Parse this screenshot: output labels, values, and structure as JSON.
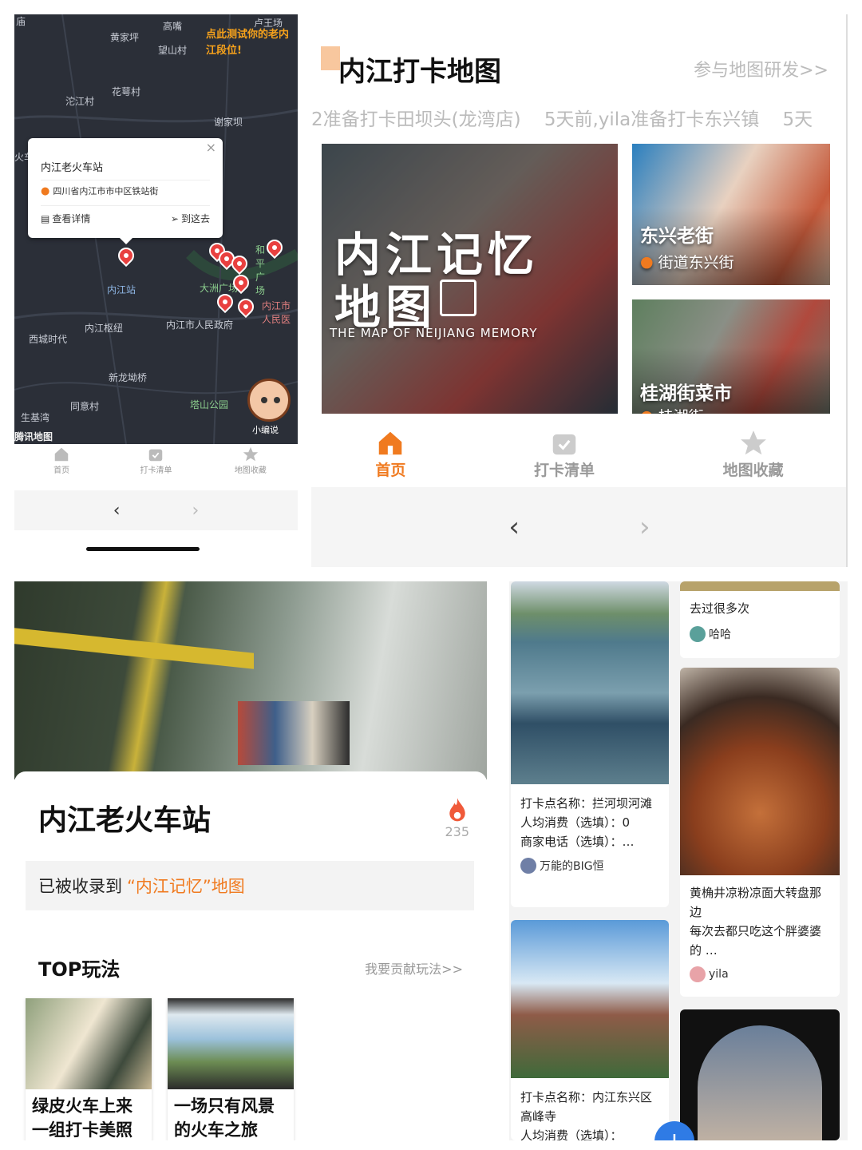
{
  "map_screen": {
    "map_labels": [
      "庙",
      "黄家坪",
      "高嘴",
      "卢王场",
      "望山村",
      "沱江村",
      "花萼村",
      "谢家坝",
      "火车",
      "内江站",
      "大洲广场",
      "和平广场",
      "内江枢纽",
      "内江市人民政府",
      "内江市人民医",
      "西城时代",
      "新龙坳桥",
      "同意村",
      "塔山公园",
      "生基湾",
      "腾讯地图"
    ],
    "promo_text": "点此测试你的老内江段位!",
    "popup": {
      "title": "内江老火车站",
      "address": "四川省内江市市中区铁站街",
      "detail_label": "查看详情",
      "goto_label": "到这去",
      "close": "×"
    },
    "mascot_label": "小编说",
    "tabs": [
      {
        "label": "首页",
        "icon": "home-icon"
      },
      {
        "label": "打卡清单",
        "icon": "checklist-icon"
      },
      {
        "label": "地图收藏",
        "icon": "star-icon"
      }
    ],
    "nav": {
      "back": "‹",
      "forward": "›"
    }
  },
  "home_screen": {
    "title": "内江打卡地图",
    "link": "参与地图研发>>",
    "ticker": "2准备打卡田坝头(龙湾店)    5天前,yila准备打卡东兴镇    5天",
    "hero": {
      "title_line1": "内江记忆",
      "title_line2": "地图",
      "subtitle": "THE MAP OF NEIJIANG MEMORY"
    },
    "cards": [
      {
        "title": "东兴老街",
        "sub": "街道东兴街"
      },
      {
        "title": "桂湖街菜市",
        "sub": "桂湖街"
      }
    ],
    "tabs": [
      {
        "label": "首页",
        "icon": "home-icon"
      },
      {
        "label": "打卡清单",
        "icon": "checklist-icon"
      },
      {
        "label": "地图收藏",
        "icon": "star-icon"
      }
    ],
    "accent": "#f07a1f",
    "nav": {
      "back": "‹",
      "forward": "›"
    }
  },
  "detail_screen": {
    "title": "内江老火车站",
    "hot_count": "235",
    "collected_prefix": "已被收录到",
    "collected_map": "“内江记忆”地图",
    "section_title": "TOP玩法",
    "section_link": "我要贡献玩法>>",
    "plays": [
      {
        "title": "绿皮火车上来",
        "sub": "一组打卡美照"
      },
      {
        "title": "一场只有风景",
        "sub": "的火车之旅"
      }
    ]
  },
  "feed_screen": {
    "top_text": "去过很多次",
    "top_user": "哈哈",
    "posts": [
      {
        "name": "打卡点名称：拦河坝河滩",
        "cost": "人均消费（选填）：0",
        "phone": "商家电话（选填）：…",
        "user": "万能的BIG恒"
      },
      {
        "desc": "黄桷井凉粉凉面大转盘那边\n每次去都只吃这个胖婆婆的 …",
        "user": "yila"
      },
      {
        "name": "打卡点名称：内江东兴区高峰寺",
        "cost": "人均消费（选填）：",
        "user": ""
      }
    ]
  }
}
